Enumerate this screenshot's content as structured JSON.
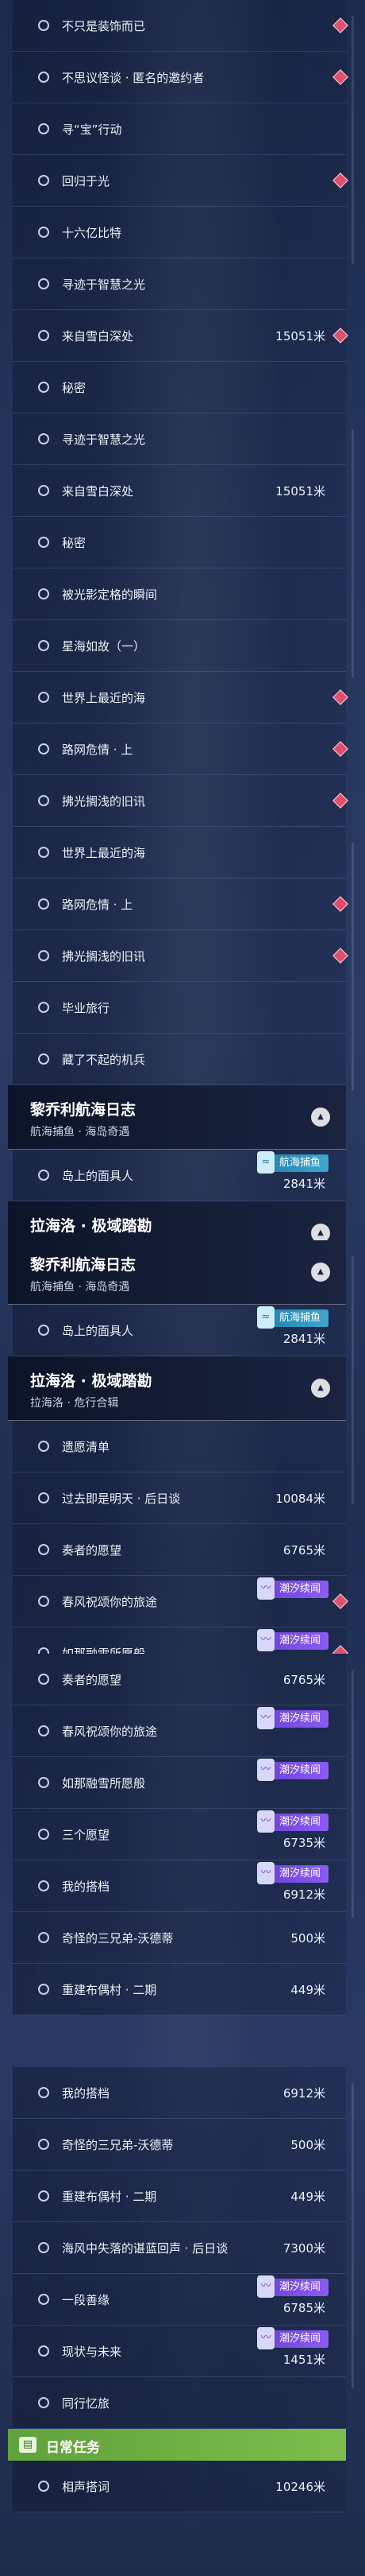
{
  "segments": [
    {
      "rows": [
        {
          "label": "不只是装饰而已",
          "diamond": true
        },
        {
          "label": "不思议怪谈 · 匿名的邀约者",
          "diamond": true
        },
        {
          "label": "寻“宝”行动"
        },
        {
          "label": "回归于光",
          "diamond": true
        },
        {
          "label": "十六亿比特"
        },
        {
          "label": "寻迹于智慧之光"
        },
        {
          "label": "来自雪白深处",
          "dist": "15051米",
          "diamond": true
        },
        {
          "label": "秘密"
        }
      ]
    },
    {
      "rows": [
        {
          "label": "寻迹于智慧之光"
        },
        {
          "label": "来自雪白深处",
          "dist": "15051米"
        },
        {
          "label": "秘密"
        },
        {
          "label": "被光影定格的瞬间"
        },
        {
          "label": "星海如故（一）"
        },
        {
          "label": "世界上最近的海",
          "diamond": true
        },
        {
          "label": "路网危情 · 上",
          "diamond": true
        },
        {
          "label": "拂光搁浅的旧讯",
          "diamond": true
        }
      ]
    },
    {
      "rows": [
        {
          "label": "世界上最近的海"
        },
        {
          "label": "路网危情 · 上",
          "diamond": true
        },
        {
          "label": "拂光搁浅的旧讯",
          "diamond": true
        },
        {
          "label": "毕业旅行"
        },
        {
          "label": "藏了不起的机兵"
        }
      ],
      "header": {
        "title": "黎乔利航海日志",
        "subtitle": "航海捕鱼 · 海岛奇遇"
      },
      "tail": [
        {
          "label": "岛上的面具人",
          "badge": "航海捕鱼",
          "badgeType": "fish",
          "dist": "2841米"
        }
      ],
      "header2": {
        "title": "拉海洛 · 极域踏勘",
        "subtitle": "拉海洛 · 危行合辑"
      }
    },
    {
      "header": {
        "title": "黎乔利航海日志",
        "subtitle": "航海捕鱼 · 海岛奇遇"
      },
      "rows": [
        {
          "label": "岛上的面具人",
          "badge": "航海捕鱼",
          "badgeType": "fish",
          "dist": "2841米"
        }
      ],
      "header2": {
        "title": "拉海洛 · 极域踏勘",
        "subtitle": "拉海洛 · 危行合辑"
      },
      "tail": [
        {
          "label": "遗愿清单"
        },
        {
          "label": "过去即是明天 · 后日谈",
          "dist": "10084米"
        },
        {
          "label": "奏者的愿望",
          "dist": "6765米"
        },
        {
          "label": "春风祝颂你的旅途",
          "badge": "潮汐续闻",
          "diamond": true
        },
        {
          "label": "如那融雪所愿般",
          "badge": "潮汐续闻",
          "diamond": true
        }
      ]
    },
    {
      "rows": [
        {
          "label": "奏者的愿望",
          "dist": "6765米"
        },
        {
          "label": "春风祝颂你的旅途",
          "badge": "潮汐续闻"
        },
        {
          "label": "如那融雪所愿般",
          "badge": "潮汐续闻"
        },
        {
          "label": "三个愿望",
          "badge": "潮汐续闻",
          "dist": "6735米"
        },
        {
          "label": "我的搭档",
          "badge": "潮汐续闻",
          "dist": "6912米"
        },
        {
          "label": "奇怪的三兄弟-沃德蒂",
          "dist": "500米"
        },
        {
          "label": "重建布偶村 · 二期",
          "dist": "449米"
        }
      ]
    },
    {
      "rows": [
        {
          "label": "我的搭档",
          "dist": "6912米"
        },
        {
          "label": "奇怪的三兄弟-沃德蒂",
          "dist": "500米"
        },
        {
          "label": "重建布偶村 · 二期",
          "dist": "449米"
        },
        {
          "label": "海风中失落的谌蓝回声 · 后日谈",
          "dist": "7300米"
        },
        {
          "label": "一段善缘",
          "badge": "潮汐续闻",
          "dist": "6785米"
        },
        {
          "label": "现状与未来",
          "badge": "潮汐续闻",
          "dist": "1451米"
        },
        {
          "label": "同行忆旅"
        }
      ],
      "daily": {
        "title": "日常任务"
      },
      "tail": [
        {
          "label": "相声搭词",
          "dist": "10246米"
        }
      ]
    }
  ]
}
